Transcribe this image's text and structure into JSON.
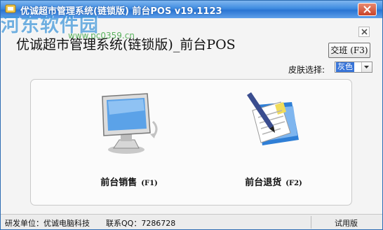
{
  "window": {
    "title": "优诚超市管理系统(链锁版) 前台POS  v19.1123"
  },
  "header": {
    "title": "优诚超市管理系统(链锁版)_前台POS",
    "shift_button_label": "交班 (F3)",
    "skin_label": "皮肤选择:",
    "skin_value": "灰色"
  },
  "watermark": {
    "text": "河东软件园",
    "sub": "www.pc0359.cn"
  },
  "tiles": [
    {
      "label": "前台销售",
      "hint": "(F1)",
      "icon": "monitor-icon"
    },
    {
      "label": "前台退货",
      "hint": "(F2)",
      "icon": "document-pen-icon"
    }
  ],
  "status": {
    "developer": "研发单位：优诚电脑科技",
    "qq": "联系QQ：7286728",
    "version": "试用版"
  },
  "colors": {
    "titlebar": "#3f8be0",
    "select_highlight": "#3874d8",
    "watermark": "#3c95d9"
  }
}
